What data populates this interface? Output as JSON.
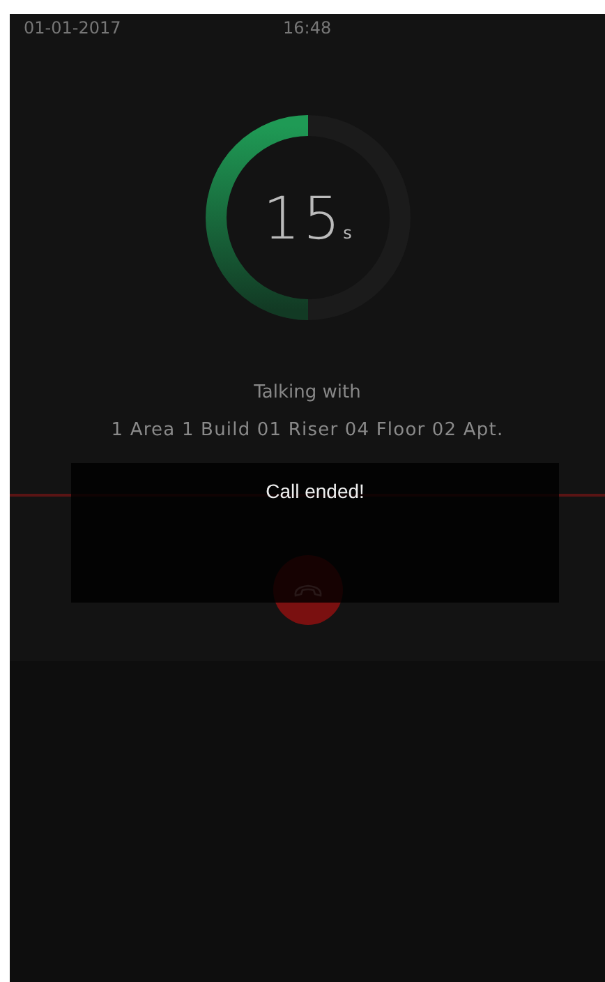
{
  "status_bar": {
    "date": "01-01-2017",
    "time": "16:48"
  },
  "countdown": {
    "value": "15",
    "unit": "s",
    "level": 0.5
  },
  "call": {
    "label": "Talking with",
    "address": "1 Area 1 Build 01 Riser 04 Floor 02 Apt."
  },
  "toast": {
    "message": "Call ended!"
  }
}
